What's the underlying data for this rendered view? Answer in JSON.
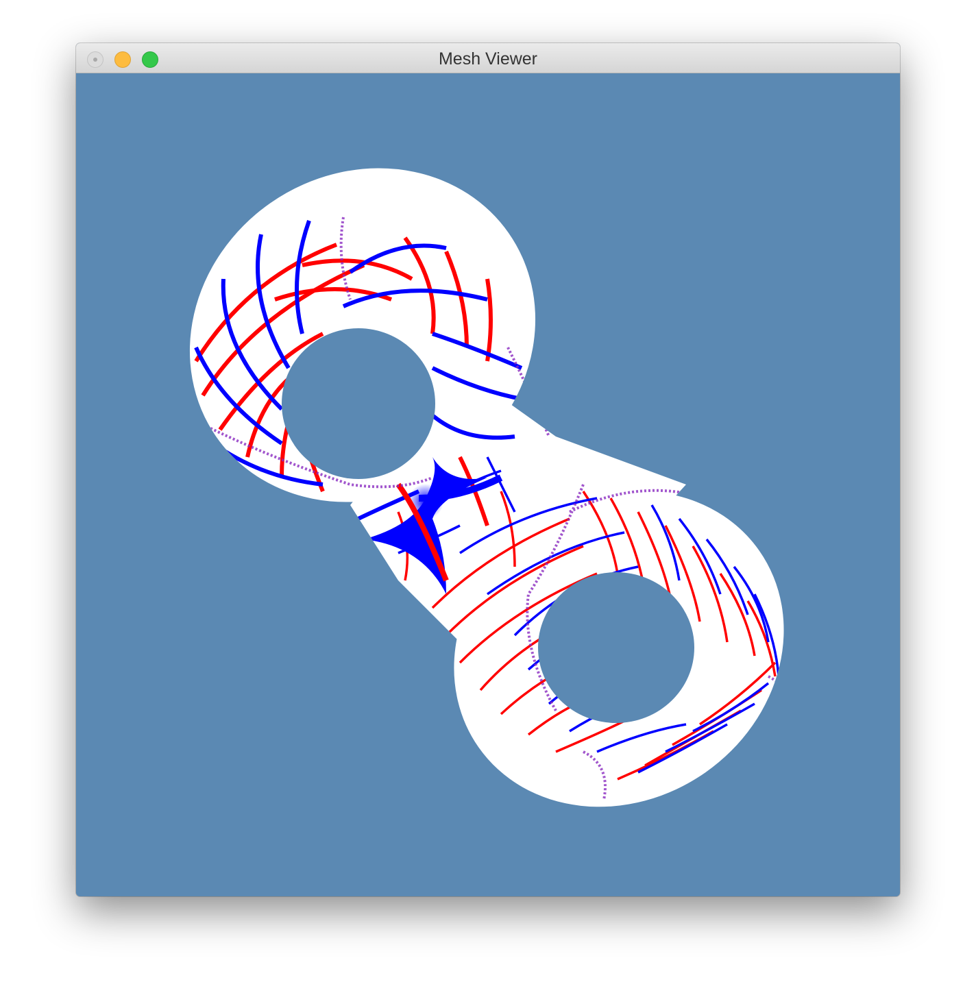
{
  "window": {
    "title": "Mesh Viewer",
    "controls": {
      "close_icon": "close-icon",
      "minimize_icon": "minimize-icon",
      "zoom_icon": "zoom-icon"
    }
  },
  "viewport": {
    "background_color": "#5b89b3",
    "mesh": {
      "surface_color": "#ffffff",
      "isoline_colors": [
        "#ff0000",
        "#0000ff"
      ],
      "shape": "double-torus"
    }
  }
}
